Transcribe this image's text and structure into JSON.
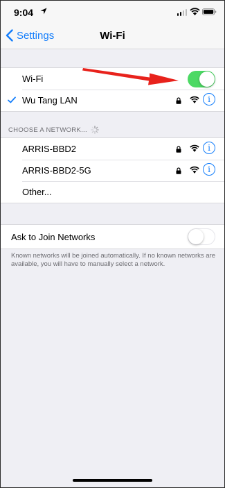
{
  "status_bar": {
    "time": "9:04"
  },
  "nav": {
    "back_label": "Settings",
    "title": "Wi-Fi"
  },
  "wifi_toggle": {
    "label": "Wi-Fi",
    "on": true
  },
  "connected_network": {
    "name": "Wu Tang LAN",
    "secured": true
  },
  "choose_header": "CHOOSE A NETWORK...",
  "networks": [
    {
      "name": "ARRIS-BBD2",
      "secured": true
    },
    {
      "name": "ARRIS-BBD2-5G",
      "secured": true
    }
  ],
  "other_label": "Other...",
  "ask_to_join": {
    "label": "Ask to Join Networks",
    "on": false
  },
  "footer_text": "Known networks will be joined automatically. If no known networks are available, you will have to manually select a network.",
  "colors": {
    "accent": "#147efb",
    "toggle_on": "#4cd964",
    "arrow": "#e8221c",
    "background": "#efeff4"
  },
  "icons": [
    "location-arrow-icon",
    "cellular-signal-icon",
    "wifi-icon",
    "battery-icon",
    "chevron-left-icon",
    "checkmark-icon",
    "lock-icon",
    "info-icon",
    "spinner-icon",
    "red-arrow-annotation"
  ]
}
